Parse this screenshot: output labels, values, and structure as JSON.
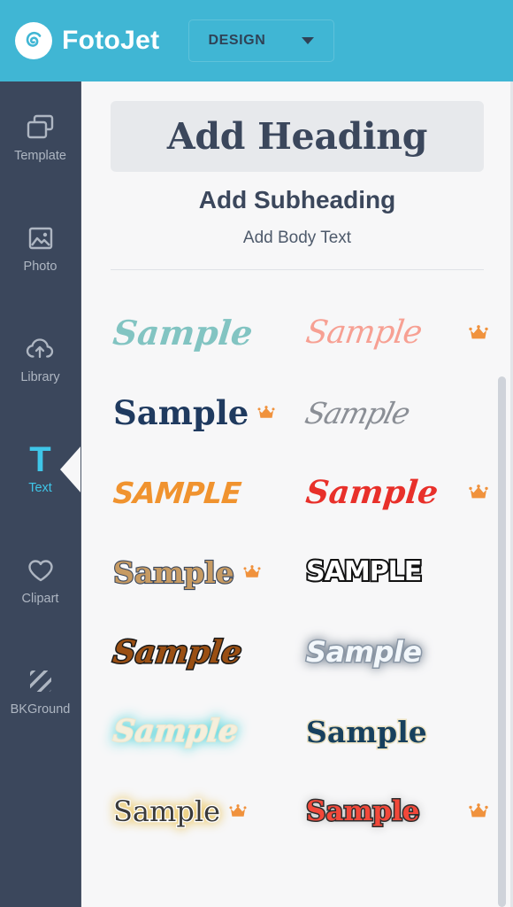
{
  "app": {
    "name": "FotoJet",
    "logo_icon": "spiral-logo-icon",
    "brand_color": "#40b6d4"
  },
  "topbar": {
    "mode_button": {
      "label": "DESIGN",
      "caret_icon": "chevron-down-icon"
    }
  },
  "sidebar": {
    "background_color": "#3b475c",
    "active_color": "#3fc6e8",
    "items": [
      {
        "label": "Template",
        "icon": "template-layers-icon",
        "active": false
      },
      {
        "label": "Photo",
        "icon": "photo-image-icon",
        "active": false
      },
      {
        "label": "Library",
        "icon": "cloud-upload-icon",
        "active": false
      },
      {
        "label": "Text",
        "icon": "text-t-icon",
        "active": true
      },
      {
        "label": "Clipart",
        "icon": "heart-icon",
        "active": false
      },
      {
        "label": "BKGround",
        "icon": "diagonal-stripes-icon",
        "active": false
      }
    ]
  },
  "main": {
    "add_heading": "Add Heading",
    "add_subheading": "Add Subheading",
    "add_body_text": "Add Body Text",
    "sample_word": "Sample",
    "sample_word_caps": "SAMPLE",
    "premium_icon": "crown-icon",
    "premium_color": "#f0923d",
    "text_styles": [
      {
        "id": "style-1",
        "label": "Sample",
        "premium": false,
        "color": "#82c4c2",
        "description": "teal brush script"
      },
      {
        "id": "style-2",
        "label": "Sample",
        "premium": true,
        "color": "#f7a093",
        "description": "salmon thin script"
      },
      {
        "id": "style-3",
        "label": "Sample",
        "premium": true,
        "color": "#1f3a5f",
        "description": "navy rough serif"
      },
      {
        "id": "style-4",
        "label": "Sample",
        "premium": false,
        "color": "#8b8f96",
        "description": "grey elegant calligraphy"
      },
      {
        "id": "style-5",
        "label": "SAMPLE",
        "premium": false,
        "color": "#f0932f",
        "description": "orange brush caps"
      },
      {
        "id": "style-6",
        "label": "Sample",
        "premium": true,
        "color": "#e8302a",
        "description": "red bold script"
      },
      {
        "id": "style-7",
        "label": "Sample",
        "premium": true,
        "color": "#c79b63",
        "description": "tan slab with navy outline"
      },
      {
        "id": "style-8",
        "label": "SAMPLE",
        "premium": false,
        "color": "#ffffff",
        "description": "white caps with black outline"
      },
      {
        "id": "style-9",
        "label": "Sample",
        "premium": false,
        "color": "#9a4f13",
        "description": "brown script with black outline"
      },
      {
        "id": "style-10",
        "label": "Sample",
        "premium": false,
        "color": "#f2f7fb",
        "description": "white italic with grey glow"
      },
      {
        "id": "style-11",
        "label": "Sample",
        "premium": false,
        "color": "#f5efdc",
        "description": "cream script with teal glow"
      },
      {
        "id": "style-12",
        "label": "Sample",
        "premium": false,
        "color": "#17405e",
        "description": "navy serif with cream outline"
      },
      {
        "id": "style-13",
        "label": "Sample",
        "premium": true,
        "color": "#3a3a3a",
        "description": "dark serif with gold glow"
      },
      {
        "id": "style-14",
        "label": "Sample",
        "premium": true,
        "color": "#f2483a",
        "description": "red serif with dark outline"
      }
    ]
  }
}
